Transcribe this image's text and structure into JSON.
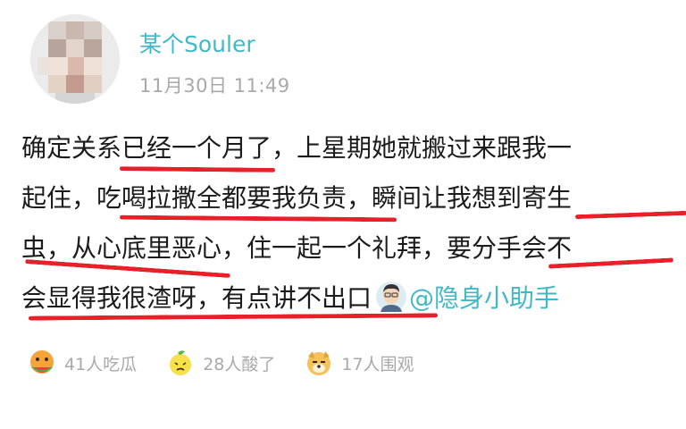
{
  "post": {
    "username": "某个Souler",
    "timestamp": "11月30日 11:49",
    "lines": [
      "确定关系已经一个月了，上星期她就搬过来跟我一",
      "起住，吃喝拉撒全都要我负责，瞬间让我想到寄生",
      "虫，从心底里恶心，住一起一个礼拜，要分手会不",
      "会显得我很渣呀，有点讲不出口"
    ],
    "mention": "@隐身小助手"
  },
  "reactions": [
    {
      "icon": "hamster-eating-melon-icon",
      "label": "41人吃瓜"
    },
    {
      "icon": "sour-lemon-icon",
      "label": "28人酸了"
    },
    {
      "icon": "dog-face-icon",
      "label": "17人围观"
    }
  ],
  "colors": {
    "accent": "#3fb9c7",
    "underline": "#e8202a",
    "meta": "#a9a9a9"
  }
}
